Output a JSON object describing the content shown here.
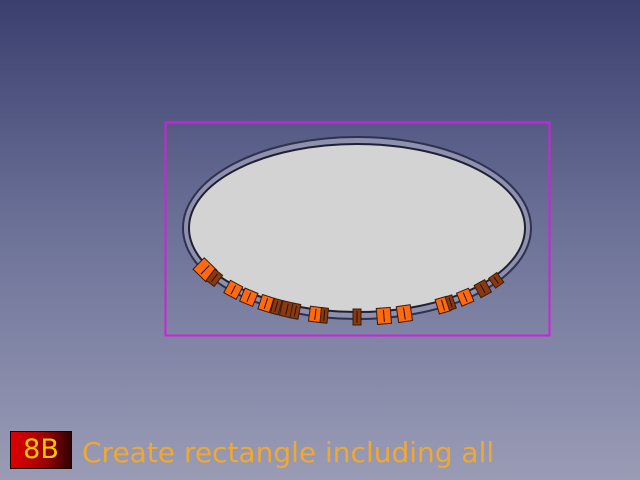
{
  "caption": {
    "step": "8B",
    "text": "Create rectangle including all"
  },
  "colors": {
    "selection_rectangle": "#cc22dd",
    "disk_fill": "#d3d3d3",
    "ring_stroke": "#3a3d5c",
    "block_orange": "#ff6a10",
    "block_dark": "#8a3a10",
    "caption_text": "#f0a830",
    "badge_text": "#f5c800",
    "badge_bg": "#c00000"
  },
  "icons": {
    "selection": "rectangle-selection-outline",
    "object": "elliptical-disk-with-segment-blocks"
  }
}
